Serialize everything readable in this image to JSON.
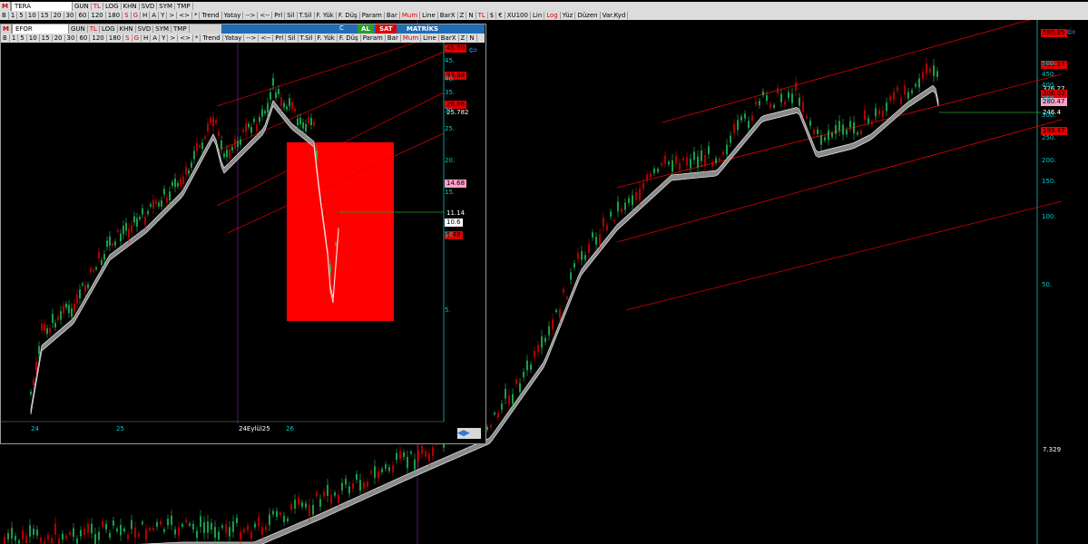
{
  "top_toolbar": {
    "symbol": "TERA",
    "row1": [
      "GUN",
      "TL",
      "LOG",
      "KHN",
      "SVD",
      "SYM",
      "TMP"
    ],
    "row2": [
      "B",
      "1",
      "5",
      "10",
      "15",
      "20",
      "30",
      "60",
      "120",
      "180",
      "S",
      "G",
      "H",
      "A",
      "Y",
      ">",
      "<>",
      "*",
      "Trend",
      "Yatay",
      "-->",
      "<--",
      "Prl",
      "Sil",
      "T.Sil",
      "F. Yük",
      "F. Düş",
      "Param",
      "Bar",
      "Mum",
      "Line",
      "BarX",
      "Z",
      "N",
      "TL",
      "$",
      "€",
      "XU100",
      "Lin",
      "Log",
      "Yüz",
      "Düzen",
      "Var.Kyd"
    ]
  },
  "sub_toolbar": {
    "symbol": "EFOR",
    "row1": [
      "GUN",
      "TL",
      "LOG",
      "KHN",
      "SVD",
      "SYM",
      "TMP"
    ],
    "row2": [
      "B",
      "1",
      "5",
      "10",
      "15",
      "20",
      "30",
      "60",
      "120",
      "180",
      "S",
      "G",
      "H",
      "A",
      "Y",
      ">",
      "<>",
      "*",
      "Trend",
      "Yatay",
      "-->",
      "<--",
      "Prl",
      "Sil",
      "T.Sil",
      "F. Yük",
      "F. Düş",
      "Param",
      "Bar",
      "Mum",
      "Line",
      "BarX",
      "Z",
      "N"
    ],
    "al_label": "AL",
    "sat_label": "SAT",
    "matriks_label": "MATRİKS"
  },
  "sub_chart": {
    "y_axis": [
      "45.",
      "40.",
      "35.",
      "30.",
      "25.",
      "20.",
      "15.",
      "10.",
      "5."
    ],
    "x_axis": [
      "24",
      "25",
      "24Eylül25",
      "26"
    ],
    "price_tags": [
      {
        "value": "45.50",
        "bg": "#e00000",
        "fg": "#000"
      },
      {
        "value": "33.98",
        "bg": "#e00000",
        "fg": "#000"
      },
      {
        "value": "28.88",
        "bg": "#e00000",
        "fg": "#000"
      },
      {
        "value": "25.782",
        "bg": "#000",
        "fg": "#fff"
      },
      {
        "value": "14.68",
        "bg": "#ff9fc8",
        "fg": "#000"
      },
      {
        "value": "11.14",
        "bg": "#000",
        "fg": "#fff"
      },
      {
        "value": "10.6",
        "bg": "#fff",
        "fg": "#000"
      },
      {
        "value": "5.48",
        "bg": "#e00000",
        "fg": "#000"
      }
    ]
  },
  "main_chart": {
    "y_axis": [
      "500.",
      "450.",
      "400.",
      "350.",
      "300.",
      "250.",
      "200.",
      "150.",
      "100.",
      "50."
    ],
    "price_tags": [
      {
        "value": "580.85",
        "bg": "#e00000",
        "fg": "#000"
      },
      {
        "value": "421.17",
        "bg": "#e00000",
        "fg": "#000"
      },
      {
        "value": "326.27",
        "bg": "#000",
        "fg": "#fff"
      },
      {
        "value": "308.02",
        "bg": "#e00000",
        "fg": "#000"
      },
      {
        "value": "280.47",
        "bg": "#ff9fc8",
        "fg": "#000"
      },
      {
        "value": "246.4",
        "bg": "#000",
        "fg": "#fff"
      },
      {
        "value": "189.47",
        "bg": "#e00000",
        "fg": "#000"
      },
      {
        "value": "7.329",
        "bg": "#000",
        "fg": "#fff"
      }
    ]
  },
  "colors": {
    "up": "#22c55e",
    "down": "#e00000",
    "ma_band": "#9a9a9a",
    "channel": "#e00000",
    "axis": "#00c8c8",
    "level": "#22a022"
  }
}
